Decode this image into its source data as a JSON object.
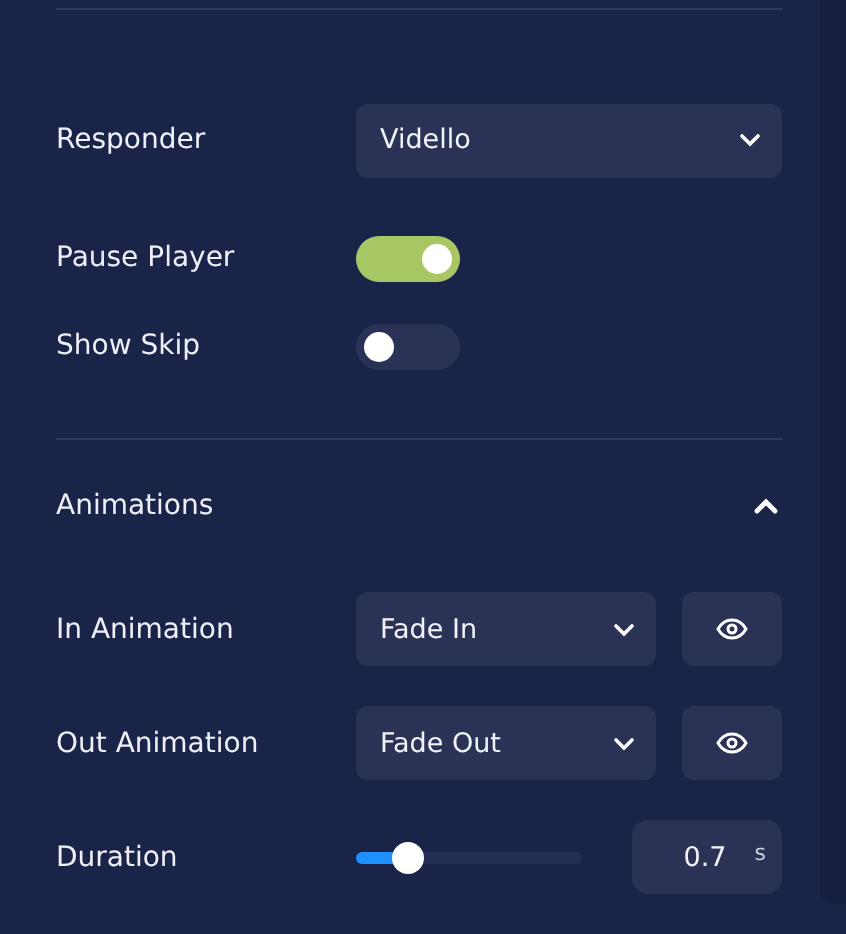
{
  "settings": [
    {
      "kind": "select",
      "label": "Responder",
      "value": "Vidello"
    },
    {
      "kind": "toggle",
      "label": "Pause Player",
      "on": true
    },
    {
      "kind": "toggle",
      "label": "Show Skip",
      "on": false
    }
  ],
  "animations": {
    "title": "Animations",
    "expanded": true,
    "rows": [
      {
        "kind": "select-preview",
        "label": "In Animation",
        "value": "Fade In"
      },
      {
        "kind": "select-preview",
        "label": "Out Animation",
        "value": "Fade Out"
      },
      {
        "kind": "slider",
        "label": "Duration",
        "level": 0.23,
        "value": "0.7",
        "unit": "s"
      }
    ]
  }
}
